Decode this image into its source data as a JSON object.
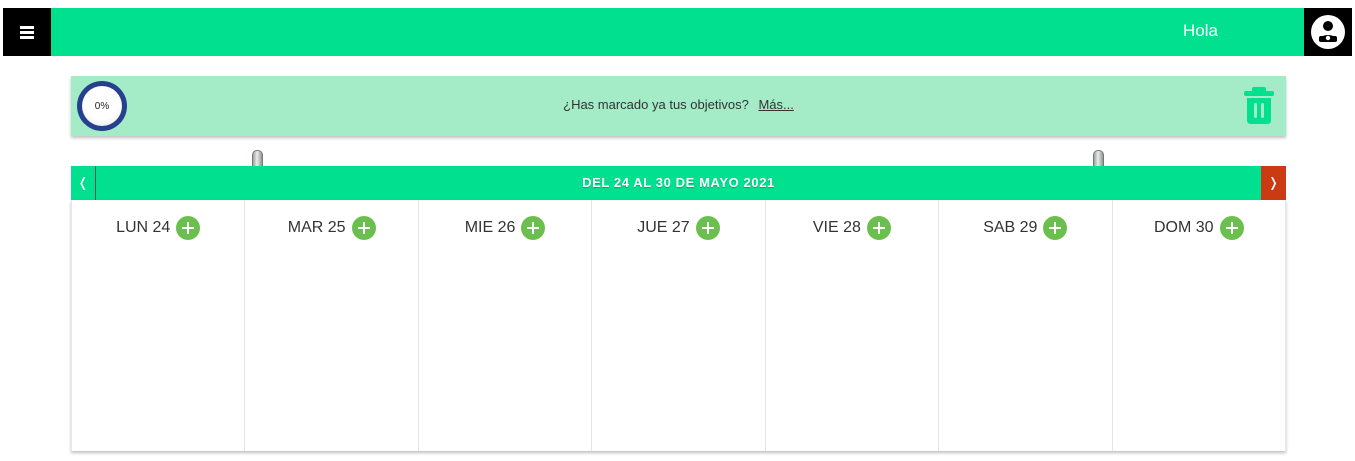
{
  "header": {
    "greeting": "Hola",
    "menu_icon": "hamburger-icon",
    "user_icon": "user-avatar-icon",
    "accent_color": "#00e08f"
  },
  "objectives": {
    "progress_label": "0%",
    "progress_value": 0,
    "question": "¿Has marcado ya tus objetivos?",
    "more_link": "Más...",
    "trash_icon": "trash-icon"
  },
  "week": {
    "title": "DEL 24 AL 30 DE MAYO 2021",
    "prev_symbol": "❬",
    "next_symbol": "❭",
    "days": [
      {
        "label": "LUN 24"
      },
      {
        "label": "MAR 25"
      },
      {
        "label": "MIE 26"
      },
      {
        "label": "JUE 27"
      },
      {
        "label": "VIE 28"
      },
      {
        "label": "SAB 29"
      },
      {
        "label": "DOM 30"
      }
    ]
  }
}
